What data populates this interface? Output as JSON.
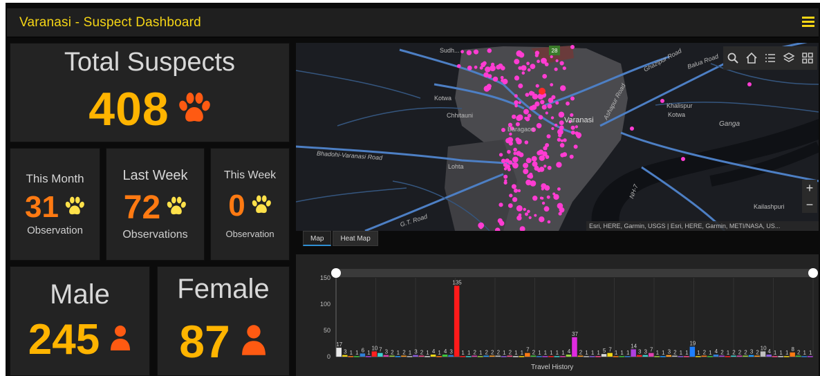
{
  "header": {
    "title": "Varanasi - Suspect Dashboard",
    "menu_icon": "hamburger-menu-icon"
  },
  "total": {
    "label": "Total Suspects",
    "value": "408",
    "icon": "paw-icon",
    "icon_color": "#ff5a12"
  },
  "this_month": {
    "label": "This Month",
    "value": "31",
    "sub": "Observation",
    "value_color": "#ff7a12",
    "icon": "paw-icon",
    "icon_color": "#ffe14a"
  },
  "last_week": {
    "label": "Last Week",
    "value": "72",
    "sub": "Observations",
    "value_color": "#ff7a12",
    "icon": "paw-icon",
    "icon_color": "#ffe14a"
  },
  "this_week": {
    "label": "This Week",
    "value": "0",
    "sub": "Observation",
    "value_color": "#ff7a12",
    "icon": "paw-icon",
    "icon_color": "#ffe14a"
  },
  "male": {
    "label": "Male",
    "value": "245",
    "icon": "person-icon",
    "icon_color": "#ff5a12"
  },
  "female": {
    "label": "Female",
    "value": "87",
    "icon": "person-icon",
    "icon_color": "#ff5a12"
  },
  "map": {
    "roads": [
      "Ghazipur Road",
      "Balua Road",
      "Bhadohi-Varanasi Road",
      "G.T. Road",
      "Ashapur Road",
      "NH-7"
    ],
    "places": [
      "Kotwa",
      "Chhitauni",
      "Varanasi",
      "Khalispur",
      "Kotwa",
      "Lohta",
      "Kailashpuri",
      "Ganga",
      "Sudh...",
      "Baragaon"
    ],
    "attribution": "Esri, HERE, Garmin, USGS | Esri, HERE, Garmin, METI/NASA, US...",
    "toolbar_icons": [
      "search-icon",
      "home-icon",
      "legend-list-icon",
      "layers-icon",
      "basemap-gallery-icon"
    ],
    "zoom_in": "+",
    "zoom_out": "−",
    "highway_badge": "28",
    "marker_color": "#ff3cd2"
  },
  "tabs": [
    {
      "label": "Map",
      "active": true
    },
    {
      "label": "Heat Map",
      "active": false
    }
  ],
  "chart_data": {
    "type": "bar",
    "xlabel": "Travel History",
    "ylabel": "",
    "ylim": [
      0,
      150
    ],
    "yticks": [
      0,
      50,
      100,
      150
    ],
    "values": [
      17,
      3,
      1,
      1,
      6,
      1,
      10,
      7,
      3,
      2,
      1,
      2,
      1,
      3,
      2,
      1,
      4,
      1,
      4,
      3,
      135,
      1,
      1,
      2,
      1,
      2,
      2,
      2,
      1,
      2,
      1,
      1,
      7,
      2,
      1,
      1,
      1,
      1,
      1,
      4,
      37,
      2,
      1,
      1,
      1,
      5,
      7,
      1,
      1,
      1,
      14,
      3,
      3,
      7,
      1,
      1,
      3,
      2,
      1,
      1,
      19,
      1,
      2,
      1,
      4,
      2,
      1,
      2,
      2,
      2,
      3,
      2,
      10,
      4,
      1,
      1,
      1,
      8,
      2,
      1,
      1
    ],
    "colors": [
      "#d9d9d9",
      "#f5d915",
      "#ff7a12",
      "#3cc83c",
      "#2f7fd9",
      "#b040e0",
      "#ff2020",
      "#3cd2d2",
      "#e040b0",
      "#9ad23c",
      "#1e9bff",
      "#ff9a1e",
      "#c0c0c0",
      "#8a5ae0",
      "#ff4a8a"
    ],
    "range_slider": "on",
    "grid": "vertical"
  }
}
